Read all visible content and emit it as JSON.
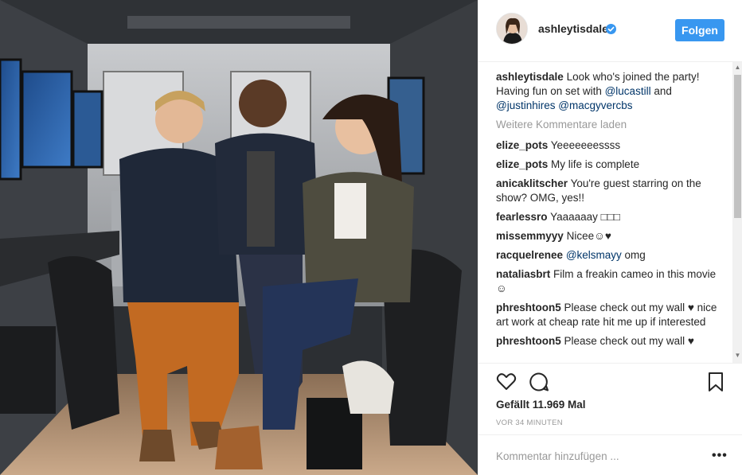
{
  "post": {
    "username": "ashleytisdale",
    "follow_label": "Folgen",
    "caption": {
      "user": "ashleytisdale",
      "text": "Look who's joined the party! Having fun on set with",
      "mention1": "@lucastill",
      "and": "and",
      "mention2": "@justinhires",
      "mention3": "@macgyvercbs"
    },
    "load_more": "Weitere Kommentare laden",
    "comments": [
      {
        "user": "elize_pots",
        "text": "Yeeeeeeessss"
      },
      {
        "user": "elize_pots",
        "text": "My life is complete"
      },
      {
        "user": "anicaklitscher",
        "text": "You're guest starring on the show? OMG, yes!!"
      },
      {
        "user": "fearlessro",
        "text": "Yaaaaaay □□□"
      },
      {
        "user": "missemmyyy",
        "text": "Nicee☺♥"
      },
      {
        "user": "racquelrenee",
        "mention": "@kelsmayy",
        "text": "omg"
      },
      {
        "user": "nataliasbrt",
        "text": "Film a freakin cameo in this movie ☺"
      },
      {
        "user": "phreshtoon5",
        "text": "Please check out my wall ♥ nice art work at cheap rate hit me up if interested"
      },
      {
        "user": "phreshtoon5",
        "text": "Please check out my wall ♥"
      }
    ],
    "likes": "Gefällt 11.969 Mal",
    "time": "VOR 34 MINUTEN",
    "add_comment_placeholder": "Kommentar hinzufügen ...",
    "more_options": "•••",
    "icons": {
      "like": "heart-icon",
      "comment": "comment-bubble-icon",
      "save": "bookmark-icon",
      "verified": "verified-badge-icon"
    },
    "colors": {
      "accent": "#3897f0",
      "mention": "#003569",
      "muted": "#999999"
    }
  }
}
